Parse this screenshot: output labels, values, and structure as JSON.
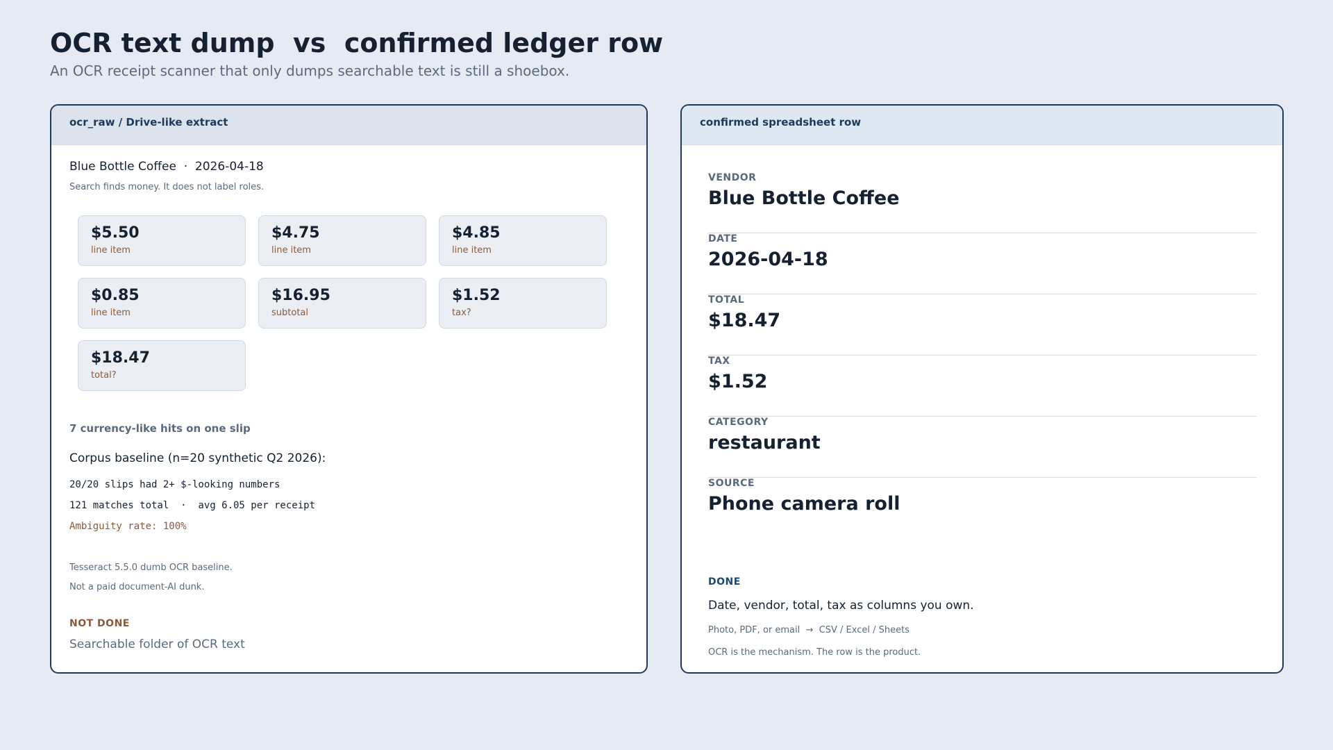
{
  "page": {
    "title": "OCR text dump  vs  confirmed ledger row",
    "subtitle": "An OCR receipt scanner that only dumps searchable text is still a shoebox."
  },
  "left": {
    "header": "ocr_raw / Drive-like extract",
    "receipt_line": "Blue Bottle Coffee  ·  2026-04-18",
    "receipt_note": "Search finds money. It does not label roles.",
    "chips": [
      {
        "amount": "$5.50",
        "role": "line item"
      },
      {
        "amount": "$4.75",
        "role": "line item"
      },
      {
        "amount": "$4.85",
        "role": "line item"
      },
      {
        "amount": "$0.85",
        "role": "line item"
      },
      {
        "amount": "$16.95",
        "role": "subtotal"
      },
      {
        "amount": "$1.52",
        "role": "tax?"
      },
      {
        "amount": "$18.47",
        "role": "total?"
      }
    ],
    "hits": "7 currency-like hits on one slip",
    "baseline_title": "Corpus baseline (n=20 synthetic Q2 2026):",
    "baseline_lines": [
      "20/20 slips had 2+ $-looking numbers",
      "121 matches total  ·  avg 6.05 per receipt",
      "Ambiguity rate: 100%"
    ],
    "notes": [
      "Tesseract 5.5.0 dumb OCR baseline.",
      "Not a paid document-AI dunk."
    ],
    "status_label": "NOT DONE",
    "status_text": "Searchable folder of OCR text"
  },
  "right": {
    "header": "confirmed spreadsheet row",
    "fields": [
      {
        "label": "VENDOR",
        "value": "Blue Bottle Coffee"
      },
      {
        "label": "DATE",
        "value": "2026-04-18"
      },
      {
        "label": "TOTAL",
        "value": "$18.47"
      },
      {
        "label": "TAX",
        "value": "$1.52"
      },
      {
        "label": "CATEGORY",
        "value": "restaurant"
      },
      {
        "label": "SOURCE",
        "value": "Phone camera roll"
      }
    ],
    "status_label": "DONE",
    "status_text": "Date, vendor, total, tax as columns you own.",
    "notes": [
      "Photo, PDF, or email  →  CSV / Excel / Sheets",
      "OCR is the mechanism. The row is the product."
    ]
  }
}
